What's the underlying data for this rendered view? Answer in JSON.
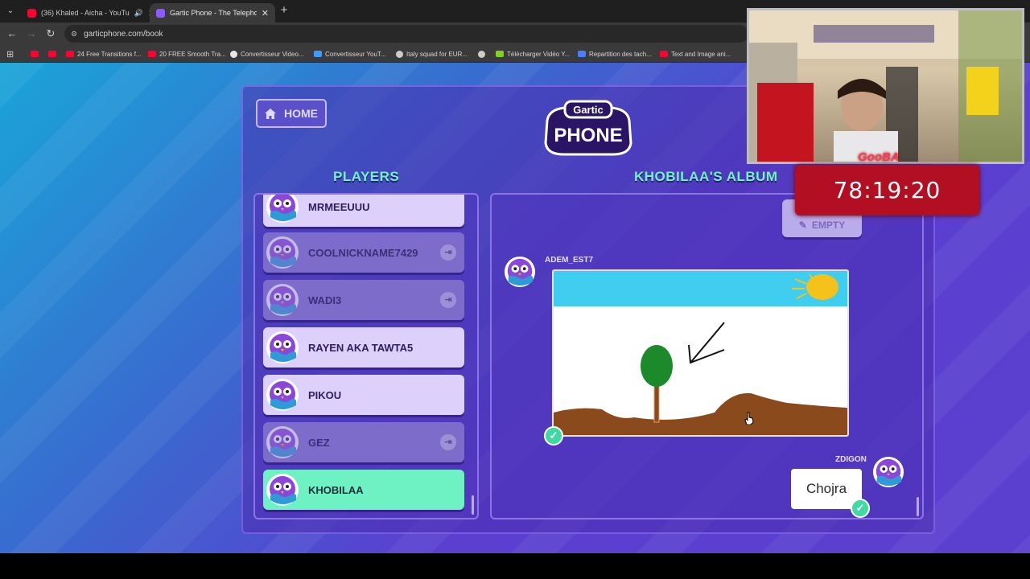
{
  "browser": {
    "tabs": [
      {
        "title": "(36) Khaled - Aicha - YouTu",
        "favicon_color": "#ff0033"
      },
      {
        "title": "Gartic Phone - The Telephone G",
        "favicon_color": "#8a5cff"
      }
    ],
    "new_tab_label": "+",
    "url": "garticphone.com/book",
    "bookmarks": [
      {
        "label": "",
        "icon_color": "#ff0033"
      },
      {
        "label": "",
        "icon_color": "#ff0033"
      },
      {
        "label": "24 Free Transitions f...",
        "icon_color": "#ff0033"
      },
      {
        "label": "20 FREE Smooth Tra...",
        "icon_color": "#ff0033"
      },
      {
        "label": "Convertisseur Video...",
        "icon_color": "#e8e8e8"
      },
      {
        "label": "Convertisseur YouT...",
        "icon_color": "#3a9cff"
      },
      {
        "label": "Italy squad for EUR...",
        "icon_color": "#cccccc"
      },
      {
        "label": "",
        "icon_color": "#cccccc"
      },
      {
        "label": "Télécharger Vidéo Y...",
        "icon_color": "#7ed321"
      },
      {
        "label": "Repartition des tach...",
        "icon_color": "#4a7dff"
      },
      {
        "label": "Text and Image ani...",
        "icon_color": "#ff0033"
      }
    ]
  },
  "game": {
    "home_label": "HOME",
    "logo_top": "Gartic",
    "logo_main": "PHONE",
    "players_heading": "PLAYERS",
    "album_heading": "KHOBILAA'S ALBUM",
    "players": [
      {
        "name": "MRMEEUUU",
        "state": "on"
      },
      {
        "name": "COOLNICKNAME7429",
        "state": "off"
      },
      {
        "name": "WADI3",
        "state": "off"
      },
      {
        "name": "RAYEN AKA TAWTA5",
        "state": "on"
      },
      {
        "name": "PIKOU",
        "state": "on"
      },
      {
        "name": "GEZ",
        "state": "off"
      },
      {
        "name": "KHOBILAA",
        "state": "me"
      }
    ],
    "empty_button": "EMPTY",
    "album": {
      "drawing_author": "ADEM_EST7",
      "answer_author": "ZDIGON",
      "answer_text": "Chojra"
    }
  },
  "stream": {
    "streamer": "GooBA",
    "timer": "78:19:20"
  },
  "colors": {
    "accent_green": "#6ff5c6",
    "panel_border": "#8a74e6",
    "timer_red": "#b30f22"
  }
}
